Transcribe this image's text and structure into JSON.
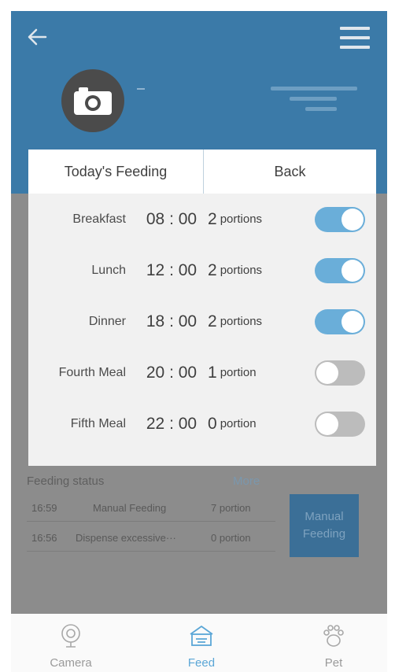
{
  "modal": {
    "tab_today": "Today's Feeding",
    "tab_back": "Back",
    "meals": [
      {
        "name": "Breakfast",
        "time": "08 : 00",
        "portion_count": "2",
        "portion_unit": "portions",
        "enabled": true
      },
      {
        "name": "Lunch",
        "time": "12 : 00",
        "portion_count": "2",
        "portion_unit": "portions",
        "enabled": true
      },
      {
        "name": "Dinner",
        "time": "18 : 00",
        "portion_count": "2",
        "portion_unit": "portions",
        "enabled": true
      },
      {
        "name": "Fourth Meal",
        "time": "20 : 00",
        "portion_count": "1",
        "portion_unit": "portion",
        "enabled": false
      },
      {
        "name": "Fifth Meal",
        "time": "22 : 00",
        "portion_count": "0",
        "portion_unit": "portion",
        "enabled": false
      }
    ]
  },
  "feeding_status": {
    "title": "Feeding status",
    "more": "More",
    "rows": [
      {
        "time": "16:59",
        "event": "Manual Feeding",
        "amount": "7 portion"
      },
      {
        "time": "16:56",
        "event": "Dispense excessive···",
        "amount": "0 portion"
      }
    ],
    "manual_button_line1": "Manual",
    "manual_button_line2": "Feeding"
  },
  "header": {
    "avatar_icon": "camera-icon",
    "back_icon": "arrow-left-icon",
    "menu_icon": "hamburger-icon"
  },
  "nav": {
    "items": [
      {
        "label": "Camera",
        "icon": "camera-lens-icon",
        "active": false
      },
      {
        "label": "Feed",
        "icon": "feeder-icon",
        "active": true
      },
      {
        "label": "Pet",
        "icon": "paw-icon",
        "active": false
      }
    ]
  },
  "colors": {
    "header_bg": "#3b7aa8",
    "toggle_on": "#6aaed9",
    "toggle_off": "#bcbcbc",
    "nav_active": "#5aa6d6"
  }
}
